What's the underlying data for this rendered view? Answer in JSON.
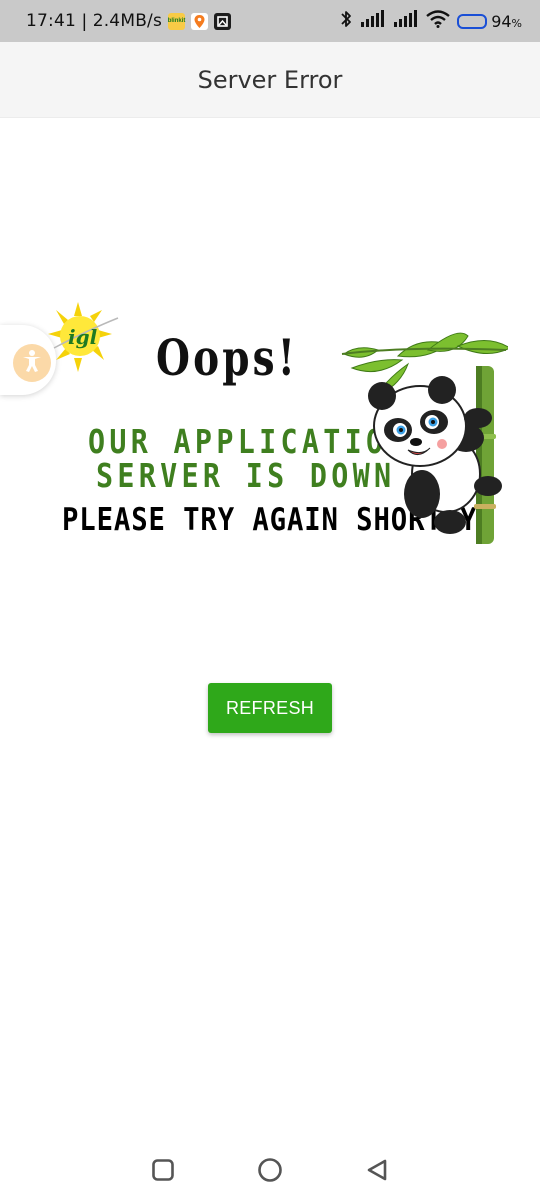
{
  "status_bar": {
    "time": "17:41",
    "separator": "|",
    "network_speed": "2.4MB/s",
    "app_icons": [
      "blinkit-icon",
      "swiggy-icon",
      "dark-app-icon"
    ],
    "blinkit_text": "blinkit",
    "battery_level": 0.94,
    "battery_text": "94",
    "battery_unit": "%",
    "icons": [
      "bluetooth-icon",
      "signal-icon",
      "signal-icon",
      "wifi-icon",
      "battery-icon"
    ]
  },
  "app_bar": {
    "title": "Server Error"
  },
  "accessibility": {
    "icon": "accessibility-icon"
  },
  "banner": {
    "logo_text": "igl",
    "heading": "Oops!",
    "line1": "OUR APPLICATION",
    "line2": "SERVER IS DOWN",
    "line3": "PLEASE TRY AGAIN SHORTLY",
    "heading_color": "#111111",
    "green": "#3f7f1f"
  },
  "actions": {
    "refresh_label": "REFRESH",
    "refresh_color": "#2fa81a"
  },
  "nav_bar": {
    "icons": [
      "recents-square-icon",
      "home-circle-icon",
      "back-triangle-icon"
    ]
  }
}
